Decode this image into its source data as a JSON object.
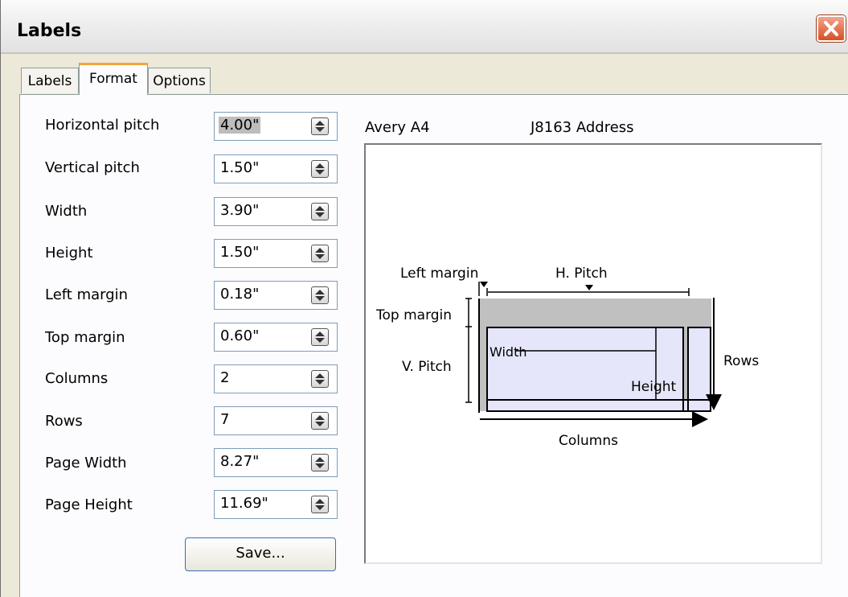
{
  "window": {
    "title": "Labels"
  },
  "tabs": [
    {
      "label": "Labels"
    },
    {
      "label": "Format"
    },
    {
      "label": "Options"
    }
  ],
  "fields": [
    {
      "label": "Horizontal pitch",
      "value": "4.00\""
    },
    {
      "label": "Vertical pitch",
      "value": "1.50\""
    },
    {
      "label": "Width",
      "value": "3.90\""
    },
    {
      "label": "Height",
      "value": "1.50\""
    },
    {
      "label": "Left margin",
      "value": "0.18\""
    },
    {
      "label": "Top margin",
      "value": "0.60\""
    },
    {
      "label": "Columns",
      "value": "2"
    },
    {
      "label": "Rows",
      "value": "7"
    },
    {
      "label": "Page Width",
      "value": "8.27\""
    },
    {
      "label": "Page Height",
      "value": "11.69\""
    }
  ],
  "save_button": {
    "label": "Save..."
  },
  "preview": {
    "brand": "Avery A4",
    "type": "J8163 Address",
    "diagram": {
      "left_margin": "Left margin",
      "h_pitch": "H. Pitch",
      "top_margin": "Top margin",
      "v_pitch": "V. Pitch",
      "width": "Width",
      "height": "Height",
      "rows": "Rows",
      "columns": "Columns"
    }
  },
  "icons": {
    "close": "close-x-icon",
    "spin": "spin-up-down-icon"
  }
}
